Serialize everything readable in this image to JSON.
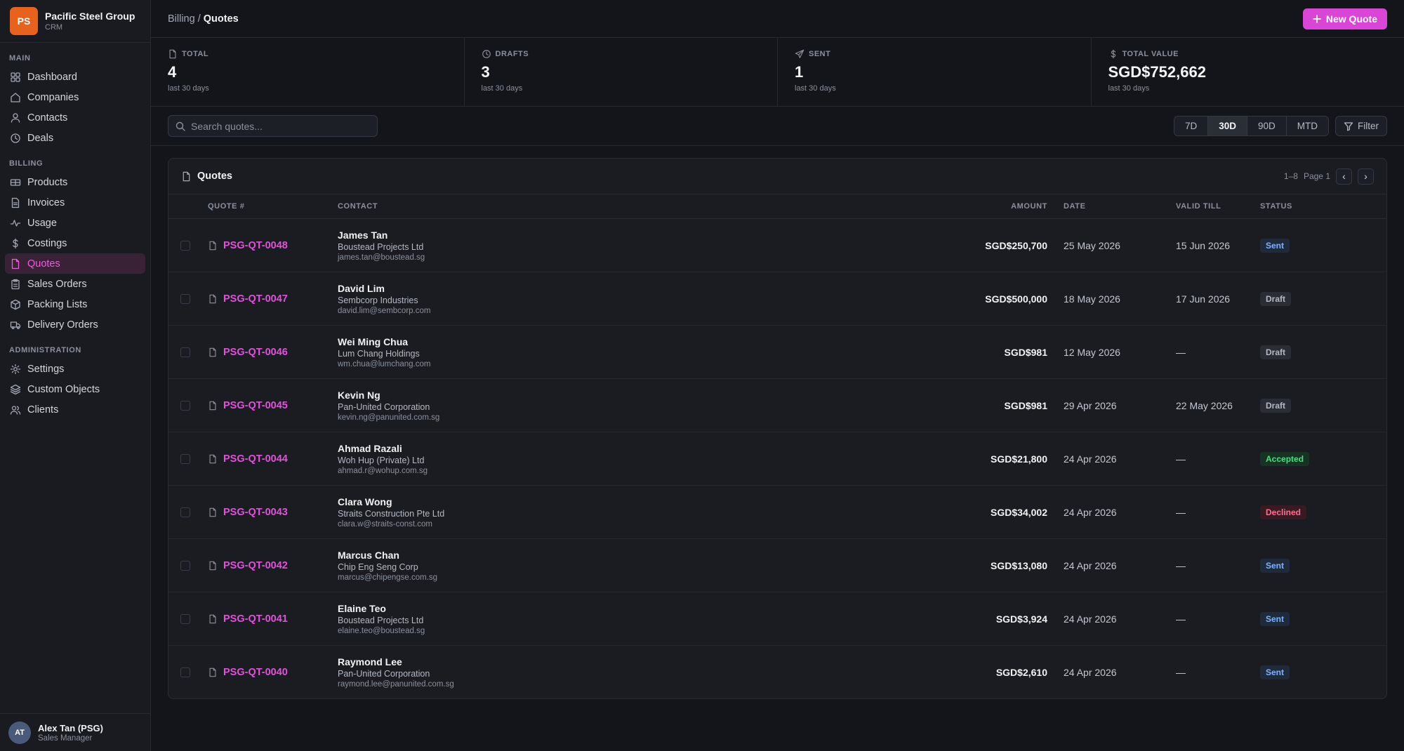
{
  "brand": {
    "logo": "PS",
    "name": "Pacific Steel Group",
    "subtitle": "CRM"
  },
  "sidebar": {
    "sections": [
      {
        "label": "MAIN",
        "items": [
          {
            "label": "Dashboard",
            "icon": "grid-icon"
          },
          {
            "label": "Companies",
            "icon": "home-icon"
          },
          {
            "label": "Contacts",
            "icon": "user-icon"
          },
          {
            "label": "Deals",
            "icon": "clock-icon"
          }
        ]
      },
      {
        "label": "BILLING",
        "items": [
          {
            "label": "Products",
            "icon": "package-icon"
          },
          {
            "label": "Invoices",
            "icon": "file-text-icon"
          },
          {
            "label": "Usage",
            "icon": "activity-icon"
          },
          {
            "label": "Costings",
            "icon": "dollar-icon"
          },
          {
            "label": "Quotes",
            "icon": "file-icon",
            "active": true
          },
          {
            "label": "Sales Orders",
            "icon": "clipboard-icon"
          },
          {
            "label": "Packing Lists",
            "icon": "box-icon"
          },
          {
            "label": "Delivery Orders",
            "icon": "truck-icon"
          }
        ]
      },
      {
        "label": "ADMINISTRATION",
        "items": [
          {
            "label": "Settings",
            "icon": "gear-icon"
          },
          {
            "label": "Custom Objects",
            "icon": "layers-icon"
          },
          {
            "label": "Clients",
            "icon": "users-icon"
          }
        ]
      }
    ]
  },
  "user": {
    "initials": "AT",
    "name": "Alex Tan (PSG)",
    "role": "Sales Manager"
  },
  "topbar": {
    "crumb_parent": "Billing",
    "crumb_sep": " / ",
    "crumb_current": "Quotes",
    "new_button": "New Quote"
  },
  "stats": [
    {
      "label": "TOTAL",
      "icon": "file-icon",
      "value": "4",
      "sub": "last 30 days"
    },
    {
      "label": "DRAFTS",
      "icon": "clock-icon",
      "value": "3",
      "sub": "last 30 days"
    },
    {
      "label": "SENT",
      "icon": "send-icon",
      "value": "1",
      "sub": "last 30 days"
    },
    {
      "label": "TOTAL VALUE",
      "icon": "dollar-icon",
      "value": "SGD$752,662",
      "sub": "last 30 days"
    }
  ],
  "toolbar": {
    "search_placeholder": "Search quotes...",
    "ranges": [
      "7D",
      "30D",
      "90D",
      "MTD"
    ],
    "active_range": "30D",
    "filter_label": "Filter"
  },
  "table": {
    "title": "Quotes",
    "range_text": "1–8",
    "page_text": "Page 1",
    "prev": "‹",
    "next": "›",
    "columns": {
      "num": "QUOTE #",
      "contact": "CONTACT",
      "amount": "AMOUNT",
      "date": "DATE",
      "valid": "VALID TILL",
      "status": "STATUS"
    },
    "rows": [
      {
        "num": "PSG-QT-0048",
        "name": "James Tan",
        "company": "Boustead Projects Ltd",
        "email": "james.tan@boustead.sg",
        "amount": "SGD$250,700",
        "date": "25 May 2026",
        "valid": "15 Jun 2026",
        "status": "Sent"
      },
      {
        "num": "PSG-QT-0047",
        "name": "David Lim",
        "company": "Sembcorp Industries",
        "email": "david.lim@sembcorp.com",
        "amount": "SGD$500,000",
        "date": "18 May 2026",
        "valid": "17 Jun 2026",
        "status": "Draft"
      },
      {
        "num": "PSG-QT-0046",
        "name": "Wei Ming Chua",
        "company": "Lum Chang Holdings",
        "email": "wm.chua@lumchang.com",
        "amount": "SGD$981",
        "date": "12 May 2026",
        "valid": "—",
        "status": "Draft"
      },
      {
        "num": "PSG-QT-0045",
        "name": "Kevin Ng",
        "company": "Pan-United Corporation",
        "email": "kevin.ng@panunited.com.sg",
        "amount": "SGD$981",
        "date": "29 Apr 2026",
        "valid": "22 May 2026",
        "status": "Draft"
      },
      {
        "num": "PSG-QT-0044",
        "name": "Ahmad Razali",
        "company": "Woh Hup (Private) Ltd",
        "email": "ahmad.r@wohup.com.sg",
        "amount": "SGD$21,800",
        "date": "24 Apr 2026",
        "valid": "—",
        "status": "Accepted"
      },
      {
        "num": "PSG-QT-0043",
        "name": "Clara Wong",
        "company": "Straits Construction Pte Ltd",
        "email": "clara.w@straits-const.com",
        "amount": "SGD$34,002",
        "date": "24 Apr 2026",
        "valid": "—",
        "status": "Declined"
      },
      {
        "num": "PSG-QT-0042",
        "name": "Marcus Chan",
        "company": "Chip Eng Seng Corp",
        "email": "marcus@chipengse.com.sg",
        "amount": "SGD$13,080",
        "date": "24 Apr 2026",
        "valid": "—",
        "status": "Sent"
      },
      {
        "num": "PSG-QT-0041",
        "name": "Elaine Teo",
        "company": "Boustead Projects Ltd",
        "email": "elaine.teo@boustead.sg",
        "amount": "SGD$3,924",
        "date": "24 Apr 2026",
        "valid": "—",
        "status": "Sent"
      },
      {
        "num": "PSG-QT-0040",
        "name": "Raymond Lee",
        "company": "Pan-United Corporation",
        "email": "raymond.lee@panunited.com.sg",
        "amount": "SGD$2,610",
        "date": "24 Apr 2026",
        "valid": "—",
        "status": "Sent"
      }
    ]
  },
  "colors": {
    "accent": "#d946d5",
    "brand": "#e8621f",
    "background": "#13151b"
  }
}
